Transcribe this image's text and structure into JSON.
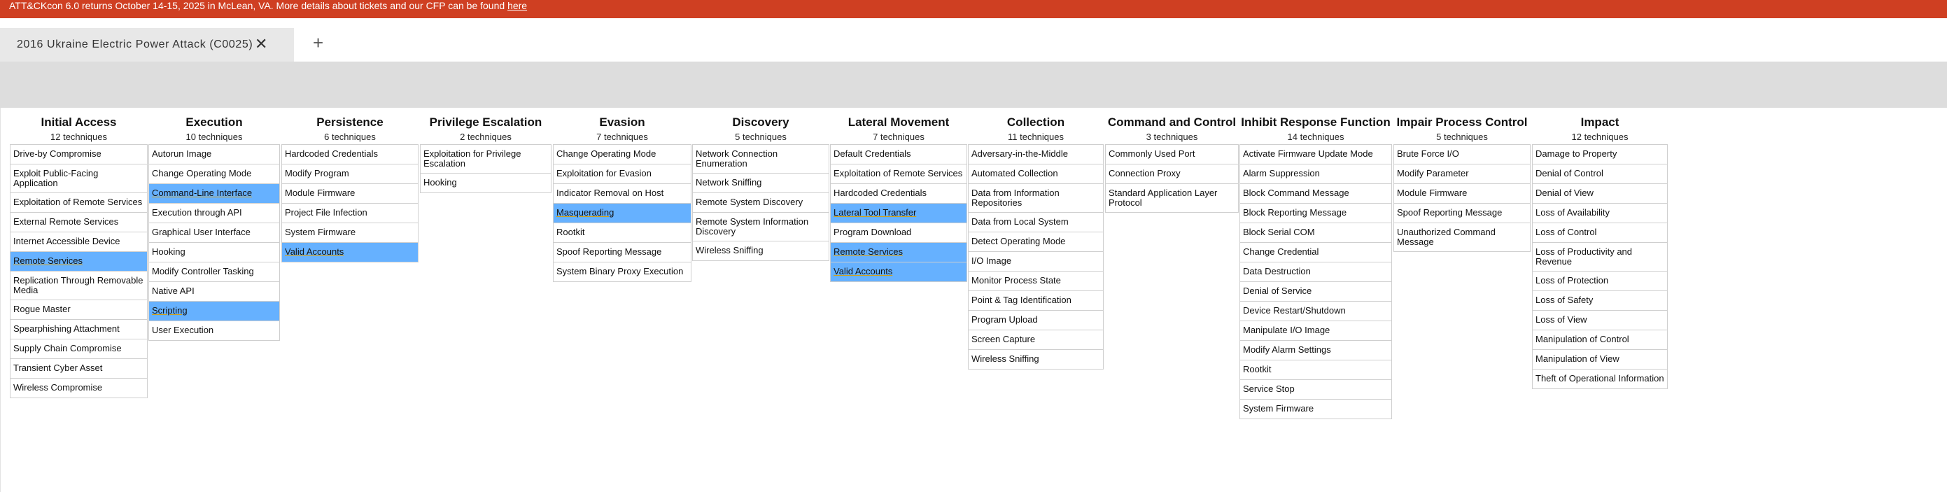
{
  "banner": {
    "text": "ATT&CKcon 6.0 returns October 14-15, 2025 in McLean, VA. More details about tickets and our CFP can be found ",
    "link": "here"
  },
  "tabs": [
    {
      "title": "2016 Ukraine Electric Power Attack (C0025)",
      "close_glyph": "✕"
    }
  ],
  "add_tab_glyph": "+",
  "colors": {
    "banner": "#cf3f22",
    "selected": "#66b1ff",
    "underline": "#d4a017",
    "toolbar_strip": "#dddddd"
  },
  "tactics": [
    {
      "name": "Initial Access",
      "count": "12  techniques",
      "techniques": [
        {
          "name": "Drive-by Compromise",
          "selected": false
        },
        {
          "name": "Exploit Public-Facing Application",
          "selected": false
        },
        {
          "name": "Exploitation of Remote Services",
          "selected": false
        },
        {
          "name": "External Remote Services",
          "selected": false
        },
        {
          "name": "Internet Accessible Device",
          "selected": false
        },
        {
          "name": "Remote Services",
          "selected": true
        },
        {
          "name": "Replication Through Removable Media",
          "selected": false
        },
        {
          "name": "Rogue Master",
          "selected": false
        },
        {
          "name": "Spearphishing Attachment",
          "selected": false
        },
        {
          "name": "Supply Chain Compromise",
          "selected": false
        },
        {
          "name": "Transient Cyber Asset",
          "selected": false
        },
        {
          "name": "Wireless Compromise",
          "selected": false
        }
      ]
    },
    {
      "name": "Execution",
      "count": "10  techniques",
      "techniques": [
        {
          "name": "Autorun Image",
          "selected": false
        },
        {
          "name": "Change Operating Mode",
          "selected": false
        },
        {
          "name": "Command-Line Interface",
          "selected": true
        },
        {
          "name": "Execution through API",
          "selected": false
        },
        {
          "name": "Graphical User Interface",
          "selected": false
        },
        {
          "name": "Hooking",
          "selected": false
        },
        {
          "name": "Modify Controller Tasking",
          "selected": false
        },
        {
          "name": "Native API",
          "selected": false
        },
        {
          "name": "Scripting",
          "selected": true
        },
        {
          "name": "User Execution",
          "selected": false
        }
      ]
    },
    {
      "name": "Persistence",
      "count": "6  techniques",
      "techniques": [
        {
          "name": "Hardcoded Credentials",
          "selected": false
        },
        {
          "name": "Modify Program",
          "selected": false
        },
        {
          "name": "Module Firmware",
          "selected": false
        },
        {
          "name": "Project File Infection",
          "selected": false
        },
        {
          "name": "System Firmware",
          "selected": false
        },
        {
          "name": "Valid Accounts",
          "selected": true
        }
      ]
    },
    {
      "name": "Privilege Escalation",
      "count": "2  techniques",
      "techniques": [
        {
          "name": "Exploitation for Privilege Escalation",
          "selected": false
        },
        {
          "name": "Hooking",
          "selected": false
        }
      ]
    },
    {
      "name": "Evasion",
      "count": "7  techniques",
      "techniques": [
        {
          "name": "Change Operating Mode",
          "selected": false
        },
        {
          "name": "Exploitation for Evasion",
          "selected": false
        },
        {
          "name": "Indicator Removal on Host",
          "selected": false
        },
        {
          "name": "Masquerading",
          "selected": true
        },
        {
          "name": "Rootkit",
          "selected": false
        },
        {
          "name": "Spoof Reporting Message",
          "selected": false
        },
        {
          "name": "System Binary Proxy Execution",
          "selected": false
        }
      ]
    },
    {
      "name": "Discovery",
      "count": "5  techniques",
      "techniques": [
        {
          "name": "Network Connection Enumeration",
          "selected": false
        },
        {
          "name": "Network Sniffing",
          "selected": false
        },
        {
          "name": "Remote System Discovery",
          "selected": false
        },
        {
          "name": "Remote System Information Discovery",
          "selected": false
        },
        {
          "name": "Wireless Sniffing",
          "selected": false
        }
      ]
    },
    {
      "name": "Lateral Movement",
      "count": "7  techniques",
      "techniques": [
        {
          "name": "Default Credentials",
          "selected": false
        },
        {
          "name": "Exploitation of Remote Services",
          "selected": false
        },
        {
          "name": "Hardcoded Credentials",
          "selected": false
        },
        {
          "name": "Lateral Tool Transfer",
          "selected": true
        },
        {
          "name": "Program Download",
          "selected": false
        },
        {
          "name": "Remote Services",
          "selected": true
        },
        {
          "name": "Valid Accounts",
          "selected": true
        }
      ]
    },
    {
      "name": "Collection",
      "count": "11  techniques",
      "techniques": [
        {
          "name": "Adversary-in-the-Middle",
          "selected": false
        },
        {
          "name": "Automated Collection",
          "selected": false
        },
        {
          "name": "Data from Information Repositories",
          "selected": false
        },
        {
          "name": "Data from Local System",
          "selected": false
        },
        {
          "name": "Detect Operating Mode",
          "selected": false
        },
        {
          "name": "I/O Image",
          "selected": false
        },
        {
          "name": "Monitor Process State",
          "selected": false
        },
        {
          "name": "Point & Tag Identification",
          "selected": false
        },
        {
          "name": "Program Upload",
          "selected": false
        },
        {
          "name": "Screen Capture",
          "selected": false
        },
        {
          "name": "Wireless Sniffing",
          "selected": false
        }
      ]
    },
    {
      "name": "Command and Control",
      "count": "3  techniques",
      "techniques": [
        {
          "name": "Commonly Used Port",
          "selected": false
        },
        {
          "name": "Connection Proxy",
          "selected": false
        },
        {
          "name": "Standard Application Layer Protocol",
          "selected": false
        }
      ]
    },
    {
      "name": "Inhibit Response Function",
      "count": "14  techniques",
      "techniques": [
        {
          "name": "Activate Firmware Update Mode",
          "selected": false
        },
        {
          "name": "Alarm Suppression",
          "selected": false
        },
        {
          "name": "Block Command Message",
          "selected": false
        },
        {
          "name": "Block Reporting Message",
          "selected": false
        },
        {
          "name": "Block Serial COM",
          "selected": false
        },
        {
          "name": "Change Credential",
          "selected": false
        },
        {
          "name": "Data Destruction",
          "selected": false
        },
        {
          "name": "Denial of Service",
          "selected": false
        },
        {
          "name": "Device Restart/Shutdown",
          "selected": false
        },
        {
          "name": "Manipulate I/O Image",
          "selected": false
        },
        {
          "name": "Modify Alarm Settings",
          "selected": false
        },
        {
          "name": "Rootkit",
          "selected": false
        },
        {
          "name": "Service Stop",
          "selected": false
        },
        {
          "name": "System Firmware",
          "selected": false
        }
      ]
    },
    {
      "name": "Impair Process Control",
      "count": "5  techniques",
      "techniques": [
        {
          "name": "Brute Force I/O",
          "selected": false
        },
        {
          "name": "Modify Parameter",
          "selected": false
        },
        {
          "name": "Module Firmware",
          "selected": false
        },
        {
          "name": "Spoof Reporting Message",
          "selected": false
        },
        {
          "name": "Unauthorized Command Message",
          "selected": false
        }
      ]
    },
    {
      "name": "Impact",
      "count": "12  techniques",
      "techniques": [
        {
          "name": "Damage to Property",
          "selected": false
        },
        {
          "name": "Denial of Control",
          "selected": false
        },
        {
          "name": "Denial of View",
          "selected": false
        },
        {
          "name": "Loss of Availability",
          "selected": false
        },
        {
          "name": "Loss of Control",
          "selected": false
        },
        {
          "name": "Loss of Productivity and Revenue",
          "selected": false
        },
        {
          "name": "Loss of Protection",
          "selected": false
        },
        {
          "name": "Loss of Safety",
          "selected": false
        },
        {
          "name": "Loss of View",
          "selected": false
        },
        {
          "name": "Manipulation of Control",
          "selected": false
        },
        {
          "name": "Manipulation of View",
          "selected": false
        },
        {
          "name": "Theft of Operational Information",
          "selected": false
        }
      ]
    }
  ]
}
